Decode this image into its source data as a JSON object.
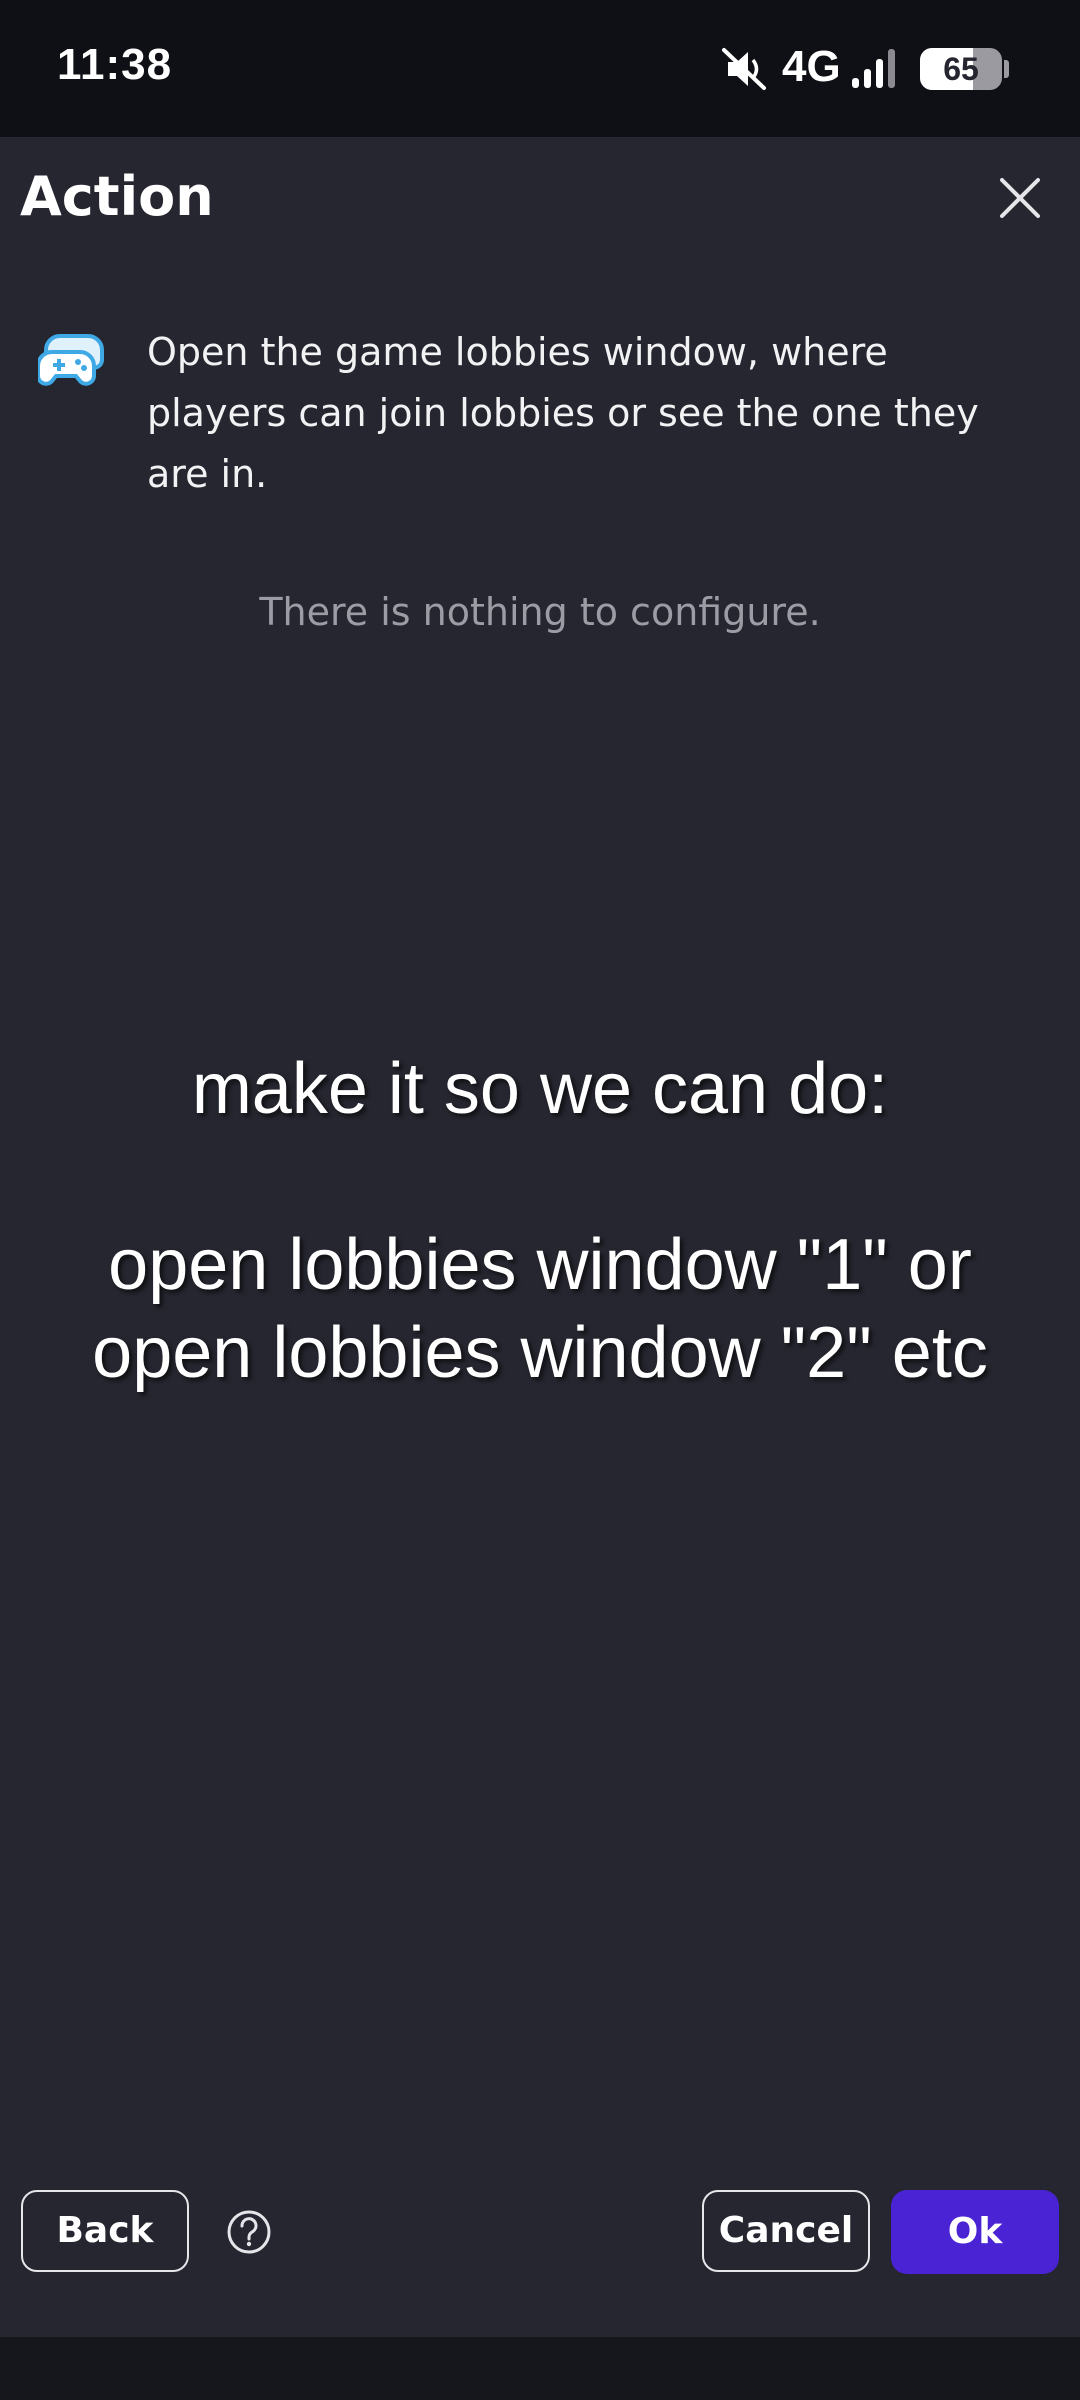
{
  "status_bar": {
    "time": "11:38",
    "network": "4G",
    "battery": "65",
    "battery_level": 0.65,
    "icons": [
      "mute-icon",
      "signal-icon",
      "battery-icon"
    ]
  },
  "dialog": {
    "title": "Action",
    "close_icon": "close-icon",
    "action_icon": "gamepad-icon",
    "description": "Open the game lobbies window, where players can join lobbies or see the one they are in.",
    "empty_config": "There is nothing to configure."
  },
  "overlay_text": {
    "line1": "make it so we can do:",
    "line2": "open lobbies window \"1\" or",
    "line3": "open lobbies window \"2\" etc"
  },
  "footer": {
    "back_label": "Back",
    "help_icon": "help-icon",
    "cancel_label": "Cancel",
    "ok_label": "Ok"
  },
  "colors": {
    "background": "#25262f",
    "status_bar": "#0f1015",
    "accent": "#4a23d4",
    "muted_text": "#9b9ca4",
    "icon_blue": "#3fa9e6"
  }
}
